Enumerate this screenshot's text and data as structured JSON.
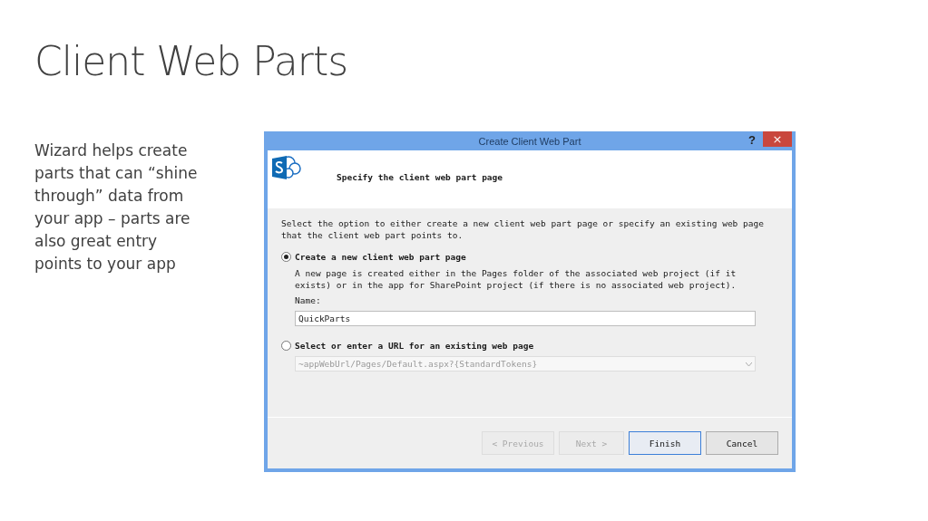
{
  "slide": {
    "title": "Client Web Parts",
    "body_lines": [
      "Wizard helps create",
      "parts that can “shine",
      "through” data from",
      "your app – parts are",
      "also great entry",
      "points to your app"
    ]
  },
  "dialog": {
    "title": "Create Client Web Part",
    "help": "?",
    "close": "×",
    "heading": "Specify the client web part page",
    "intro": "Select the option to either create a new client web part page or specify an existing web page that the client web part points to.",
    "options": [
      {
        "label": "Create a new client web part page",
        "selected": true,
        "description": "A new page is created either in the Pages folder of the associated web project (if it exists) or in the app for SharePoint project (if there is no associated web project).",
        "field_label": "Name:",
        "field": {
          "kind": "text",
          "value": "QuickParts",
          "disabled": false
        }
      },
      {
        "label": "Select or enter a URL for an existing web page",
        "selected": false,
        "field": {
          "kind": "combo",
          "value": "~appWebUrl/Pages/Default.aspx?{StandardTokens}",
          "disabled": true
        }
      }
    ],
    "buttons": [
      {
        "label": "< Previous",
        "disabled": true,
        "default": false
      },
      {
        "label": "Next >",
        "disabled": true,
        "default": false
      },
      {
        "label": "Finish",
        "disabled": false,
        "default": true
      },
      {
        "label": "Cancel",
        "disabled": false,
        "default": false
      }
    ]
  }
}
